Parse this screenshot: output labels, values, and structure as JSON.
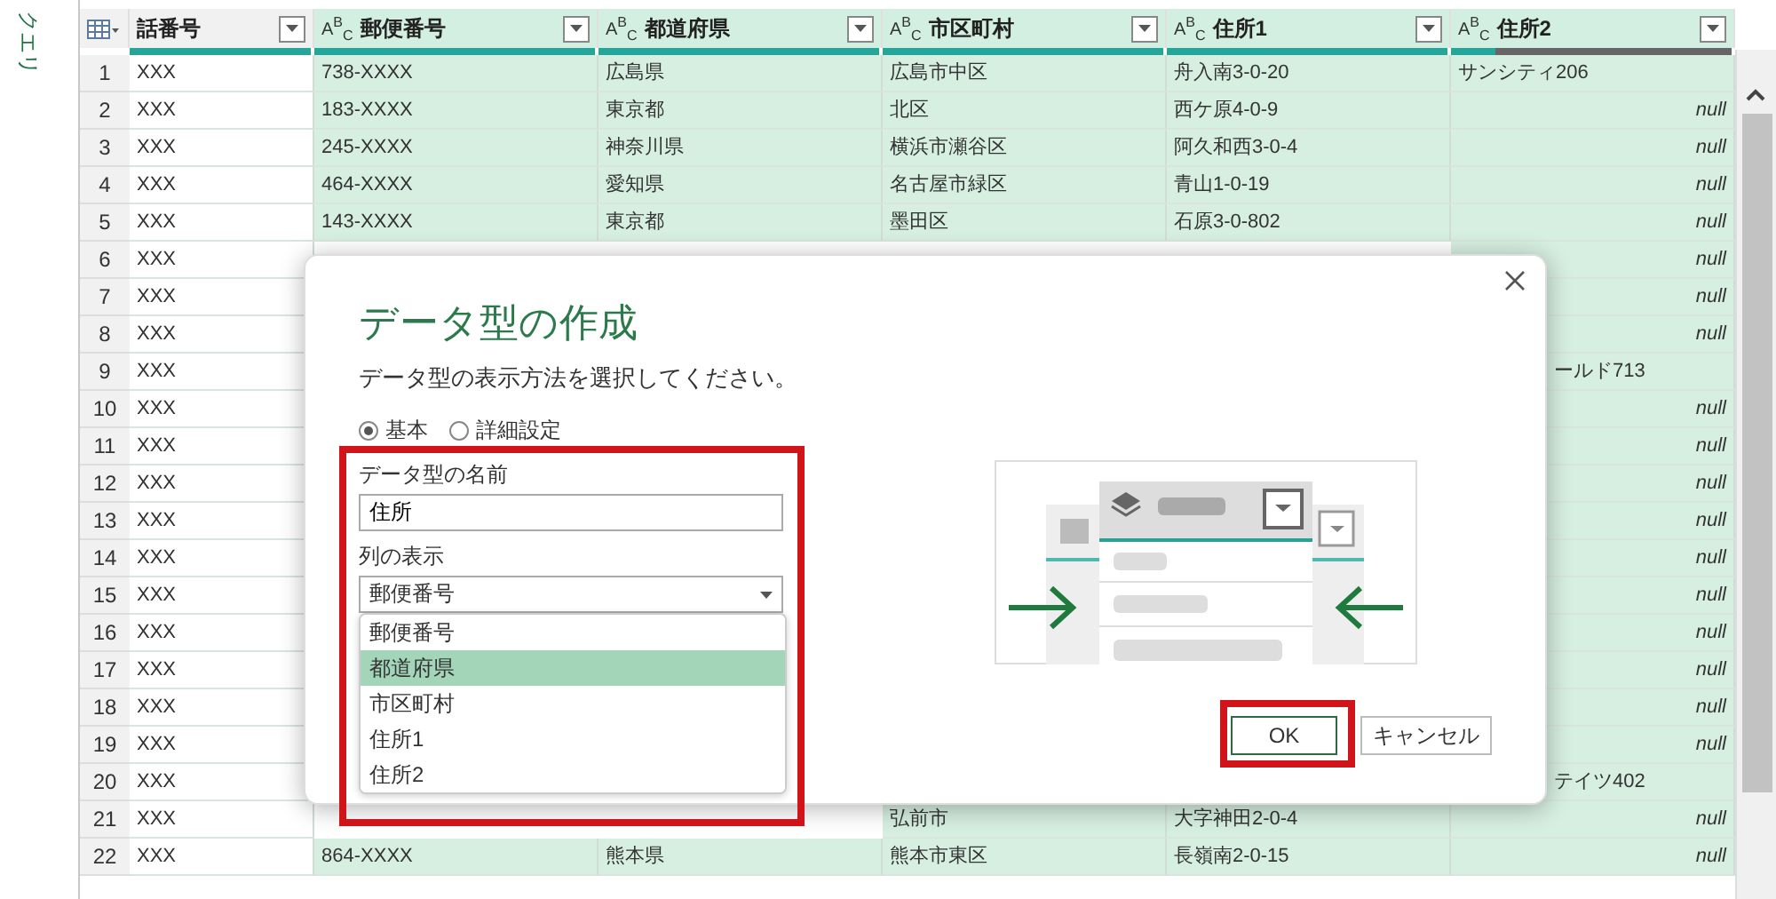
{
  "side_panel": {
    "title": "クエリ"
  },
  "table": {
    "columns": [
      {
        "label": "話番号",
        "level": 1
      },
      {
        "label": "郵便番号",
        "type": "A$^{B}$$_{C}$",
        "level": 1
      },
      {
        "label": "都道府県",
        "type": "A$^{B}$$_{C}$",
        "level": 1
      },
      {
        "label": "市区町村",
        "type": "A$^{B}$$_{C}$",
        "level": 1
      },
      {
        "label": "住所1",
        "type": "A$^{B}$$_{C}$",
        "level": 1
      },
      {
        "label": "住所2",
        "type": "A$^{B}$$_{C}$",
        "level": 0.16
      }
    ],
    "rows": [
      {
        "n": "1",
        "cells": [
          "XXX",
          "738-XXXX",
          "広島県",
          "広島市中区",
          "舟入南3-0-20"
        ],
        "address2": {
          "text": "サンシティ206",
          "kind": "value"
        }
      },
      {
        "n": "2",
        "cells": [
          "XXX",
          "183-XXXX",
          "東京都",
          "北区",
          "西ケ原4-0-9"
        ],
        "address2": {
          "text": "null",
          "kind": "null"
        }
      },
      {
        "n": "3",
        "cells": [
          "XXX",
          "245-XXXX",
          "神奈川県",
          "横浜市瀬谷区",
          "阿久和西3-0-4"
        ],
        "address2": {
          "text": "null",
          "kind": "null"
        }
      },
      {
        "n": "4",
        "cells": [
          "XXX",
          "464-XXXX",
          "愛知県",
          "名古屋市緑区",
          "青山1-0-19"
        ],
        "address2": {
          "text": "null",
          "kind": "null"
        }
      },
      {
        "n": "5",
        "cells": [
          "XXX",
          "143-XXXX",
          "東京都",
          "墨田区",
          "石原3-0-802"
        ],
        "address2": {
          "text": "null",
          "kind": "null"
        }
      },
      {
        "n": "6",
        "cells": [
          "XXX",
          null,
          null,
          null,
          null
        ],
        "address2": {
          "text": "null",
          "kind": "null"
        }
      },
      {
        "n": "7",
        "cells": [
          "XXX",
          null,
          null,
          null,
          null
        ],
        "address2": {
          "text": "null",
          "kind": "null"
        }
      },
      {
        "n": "8",
        "cells": [
          "XXX",
          null,
          null,
          null,
          null
        ],
        "address2": {
          "text": "null",
          "kind": "null"
        }
      },
      {
        "n": "9",
        "cells": [
          "XXX",
          null,
          null,
          null,
          null
        ],
        "address2": {
          "text": "ールド713",
          "kind": "cut"
        }
      },
      {
        "n": "10",
        "cells": [
          "XXX",
          null,
          null,
          null,
          null
        ],
        "address2": {
          "text": "null",
          "kind": "null"
        }
      },
      {
        "n": "11",
        "cells": [
          "XXX",
          null,
          null,
          null,
          null
        ],
        "address2": {
          "text": "null",
          "kind": "null"
        }
      },
      {
        "n": "12",
        "cells": [
          "XXX",
          null,
          null,
          null,
          null
        ],
        "address2": {
          "text": "null",
          "kind": "null"
        }
      },
      {
        "n": "13",
        "cells": [
          "XXX",
          null,
          null,
          null,
          null
        ],
        "address2": {
          "text": "null",
          "kind": "null"
        }
      },
      {
        "n": "14",
        "cells": [
          "XXX",
          null,
          null,
          null,
          null
        ],
        "address2": {
          "text": "null",
          "kind": "null"
        }
      },
      {
        "n": "15",
        "cells": [
          "XXX",
          null,
          null,
          null,
          null
        ],
        "address2": {
          "text": "null",
          "kind": "null"
        }
      },
      {
        "n": "16",
        "cells": [
          "XXX",
          null,
          null,
          null,
          null
        ],
        "address2": {
          "text": "null",
          "kind": "null"
        }
      },
      {
        "n": "17",
        "cells": [
          "XXX",
          null,
          null,
          null,
          null
        ],
        "address2": {
          "text": "null",
          "kind": "null"
        }
      },
      {
        "n": "18",
        "cells": [
          "XXX",
          null,
          null,
          null,
          null
        ],
        "address2": {
          "text": "null",
          "kind": "null"
        }
      },
      {
        "n": "19",
        "cells": [
          "XXX",
          null,
          null,
          null,
          null
        ],
        "address2": {
          "text": "null",
          "kind": "null"
        }
      },
      {
        "n": "20",
        "cells": [
          "XXX",
          null,
          null,
          null,
          null
        ],
        "address2": {
          "text": "テイツ402",
          "kind": "cut"
        }
      },
      {
        "n": "21",
        "cells": [
          "XXX",
          null,
          null,
          "弘前市",
          "大字神田2-0-4"
        ],
        "address2": {
          "text": "null",
          "kind": "null"
        }
      },
      {
        "n": "22",
        "cells": [
          "XXX",
          "864-XXXX",
          "熊本県",
          "熊本市東区",
          "長嶺南2-0-15"
        ],
        "address2": {
          "text": "null",
          "kind": "null"
        }
      }
    ]
  },
  "dialog": {
    "title": "データ型の作成",
    "subtitle": "データ型の表示方法を選択してください。",
    "modes": [
      {
        "label": "基本",
        "selected": true
      },
      {
        "label": "詳細設定",
        "selected": false
      }
    ],
    "name_label": "データ型の名前",
    "name_value": "住所",
    "display_label": "列の表示",
    "display_value": "郵便番号",
    "options": [
      {
        "label": "郵便番号",
        "selected": false
      },
      {
        "label": "都道府県",
        "selected": true
      },
      {
        "label": "市区町村",
        "selected": false
      },
      {
        "label": "住所1",
        "selected": false
      },
      {
        "label": "住所2",
        "selected": false
      }
    ],
    "buttons": [
      {
        "label": "OK",
        "kind": "primary"
      },
      {
        "label": "キャンセル",
        "kind": "secondary"
      }
    ]
  }
}
